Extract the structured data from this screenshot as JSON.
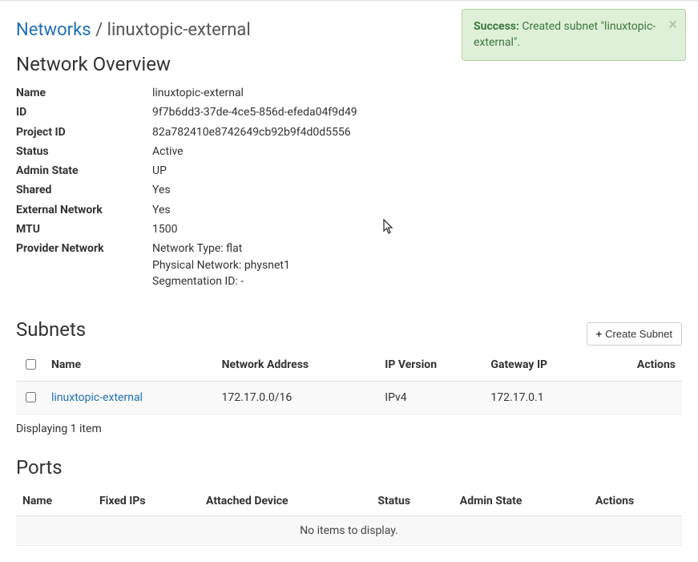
{
  "alert": {
    "strong": "Success:",
    "text": " Created subnet \"linuxtopic-external\"."
  },
  "breadcrumb": {
    "root": "Networks",
    "sep": " / ",
    "current": "linuxtopic-external"
  },
  "overview": {
    "heading": "Network Overview",
    "labels": {
      "name": "Name",
      "id": "ID",
      "project_id": "Project ID",
      "status": "Status",
      "admin_state": "Admin State",
      "shared": "Shared",
      "external": "External Network",
      "mtu": "MTU",
      "provider": "Provider Network"
    },
    "values": {
      "name": "linuxtopic-external",
      "id": "9f7b6dd3-37de-4ce5-856d-efeda04f9d49",
      "project_id": "82a782410e8742649cb92b9f4d0d5556",
      "status": "Active",
      "admin_state": "UP",
      "shared": "Yes",
      "external": "Yes",
      "mtu": "1500",
      "provider_type": "Network Type: flat",
      "provider_physical": "Physical Network: physnet1",
      "provider_seg": "Segmentation ID: -"
    }
  },
  "subnets": {
    "heading": "Subnets",
    "create_label": "Create Subnet",
    "columns": {
      "name": "Name",
      "address": "Network Address",
      "ipver": "IP Version",
      "gateway": "Gateway IP",
      "actions": "Actions"
    },
    "rows": [
      {
        "name": "linuxtopic-external",
        "address": "172.17.0.0/16",
        "ipver": "IPv4",
        "gateway": "172.17.0.1"
      }
    ],
    "displaying": "Displaying 1 item"
  },
  "ports": {
    "heading": "Ports",
    "columns": {
      "name": "Name",
      "fixed_ips": "Fixed IPs",
      "attached": "Attached Device",
      "status": "Status",
      "admin_state": "Admin State",
      "actions": "Actions"
    },
    "empty": "No items to display."
  }
}
